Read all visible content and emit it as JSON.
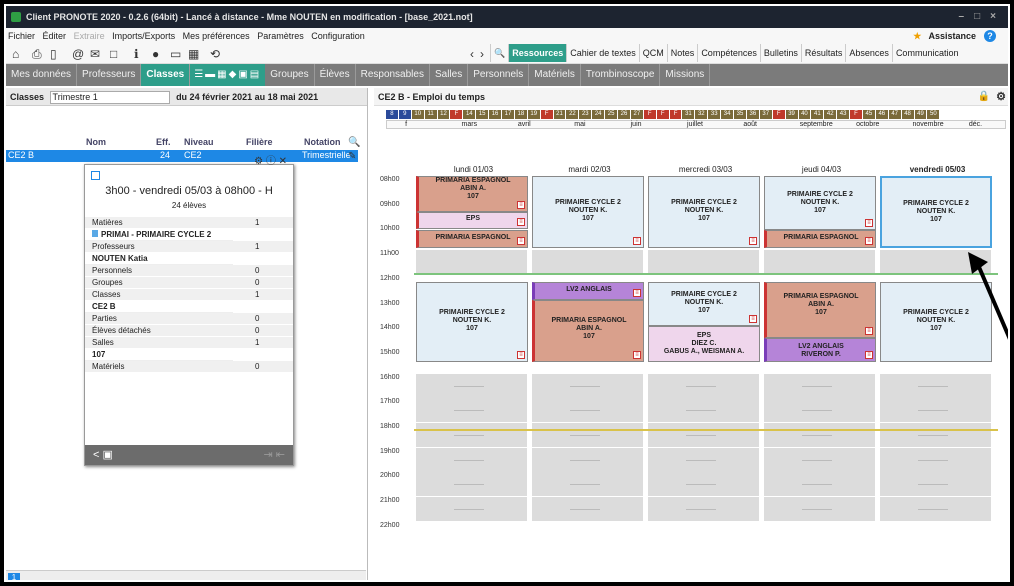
{
  "window": {
    "title": "Client PRONOTE 2020 - 0.2.6 (64bit) - Lancé à distance - Mme NOUTEN en modification - [base_2021.not]"
  },
  "menu": [
    "Fichier",
    "Éditer",
    "Extraire",
    "Imports/Exports",
    "Mes préférences",
    "Paramètres",
    "Configuration"
  ],
  "assistance": "Assistance",
  "topnav": [
    "Ressources",
    "Cahier de textes",
    "QCM",
    "Notes",
    "Compétences",
    "Bulletins",
    "Résultats",
    "Absences",
    "Communication"
  ],
  "navbar": {
    "before": [
      "Mes données",
      "Professeurs"
    ],
    "active": "Classes",
    "after": [
      "Groupes",
      "Élèves",
      "Responsables",
      "Salles",
      "Personnels",
      "Matériels",
      "Trombinoscope",
      "Missions"
    ]
  },
  "left": {
    "label": "Classes",
    "period": "Trimestre 1",
    "range": "du 24 février 2021 au 18 mai 2021",
    "cols": [
      "Nom",
      "Eff.",
      "Niveau",
      "Filière",
      "Notation"
    ],
    "row": {
      "nom": "CE2 B",
      "eff": "24",
      "niveau": "CE2",
      "notation": "Trimestrielle"
    },
    "card": {
      "title": "3h00 - vendredi 05/03 à 08h00 - H",
      "eleves": "24 élèves",
      "rows": [
        {
          "label": "Matières",
          "n": "1",
          "value": "PRIMAI - PRIMAIRE CYCLE 2"
        },
        {
          "label": "Professeurs",
          "n": "1",
          "value": "NOUTEN Katia"
        },
        {
          "label": "Personnels",
          "n": "0"
        },
        {
          "label": "Groupes",
          "n": "0"
        },
        {
          "label": "Classes",
          "n": "1",
          "value": "CE2 B"
        },
        {
          "label": "Parties",
          "n": "0"
        },
        {
          "label": "Élèves détachés",
          "n": "0"
        },
        {
          "label": "Salles",
          "n": "1",
          "value": "107"
        },
        {
          "label": "Matériels",
          "n": "0"
        }
      ]
    }
  },
  "right": {
    "title": "CE2 B - Emploi du temps",
    "weeks": [
      "8",
      "9",
      "10",
      "11",
      "12",
      "F",
      "14",
      "15",
      "16",
      "17",
      "18",
      "19",
      "F",
      "21",
      "22",
      "23",
      "24",
      "25",
      "26",
      "27",
      "F",
      "F",
      "F",
      "31",
      "32",
      "33",
      "34",
      "35",
      "36",
      "37",
      "F",
      "39",
      "40",
      "41",
      "42",
      "43",
      "F",
      "45",
      "46",
      "47",
      "48",
      "49",
      "50"
    ],
    "months": [
      "f",
      "mars",
      "avril",
      "mai",
      "juin",
      "juillet",
      "août",
      "septembre",
      "octobre",
      "novembre",
      "déc."
    ],
    "days": [
      "lundi 01/03",
      "mardi 02/03",
      "mercredi 03/03",
      "jeudi 04/03",
      "vendredi 05/03"
    ],
    "hours": [
      "08h00",
      "09h00",
      "10h00",
      "11h00",
      "12h00",
      "13h00",
      "14h00",
      "15h00",
      "16h00",
      "17h00",
      "18h00",
      "19h00",
      "20h00",
      "21h00",
      "22h00"
    ],
    "events": {
      "e1": "PRIMARIA ESPAGNOL\nABIN A.\n107",
      "e2": "EPS",
      "e3": "PRIMARIA ESPAGNOL",
      "e4": "PRIMAIRE CYCLE 2\nNOUTEN K.\n107",
      "e5": "PRIMAIRE CYCLE 2\nNOUTEN K.\n107",
      "e6": "PRIMAIRE CYCLE 2\nNOUTEN K.\n107",
      "e7": "PRIMARIA ESPAGNOL",
      "e8": "PRIMAIRE CYCLE 2\nNOUTEN K.\n107",
      "e9": "PRIMAIRE CYCLE 2\nNOUTEN K.\n107",
      "e10": "LV2 ANGLAIS",
      "e11": "PRIMARIA ESPAGNOL\nABIN A.\n107",
      "e12": "PRIMAIRE CYCLE 2\nNOUTEN K.\n107",
      "e13": "EPS\nDIEZ C.\nGABUS A., WEISMAN A.",
      "e14": "PRIMARIA ESPAGNOL\nABIN A.\n107",
      "e15": "LV2 ANGLAIS\nRIVERON P.",
      "e16": "PRIMAIRE CYCLE 2\nNOUTEN K.\n107"
    }
  },
  "colors": {
    "accent": "#2e9e8a",
    "selection": "#1e88e5",
    "blueEvent": "#e3eef6",
    "redEvent": "#d9a08c",
    "purpleEvent": "#b584d8"
  },
  "footer": {
    "page": "1"
  }
}
